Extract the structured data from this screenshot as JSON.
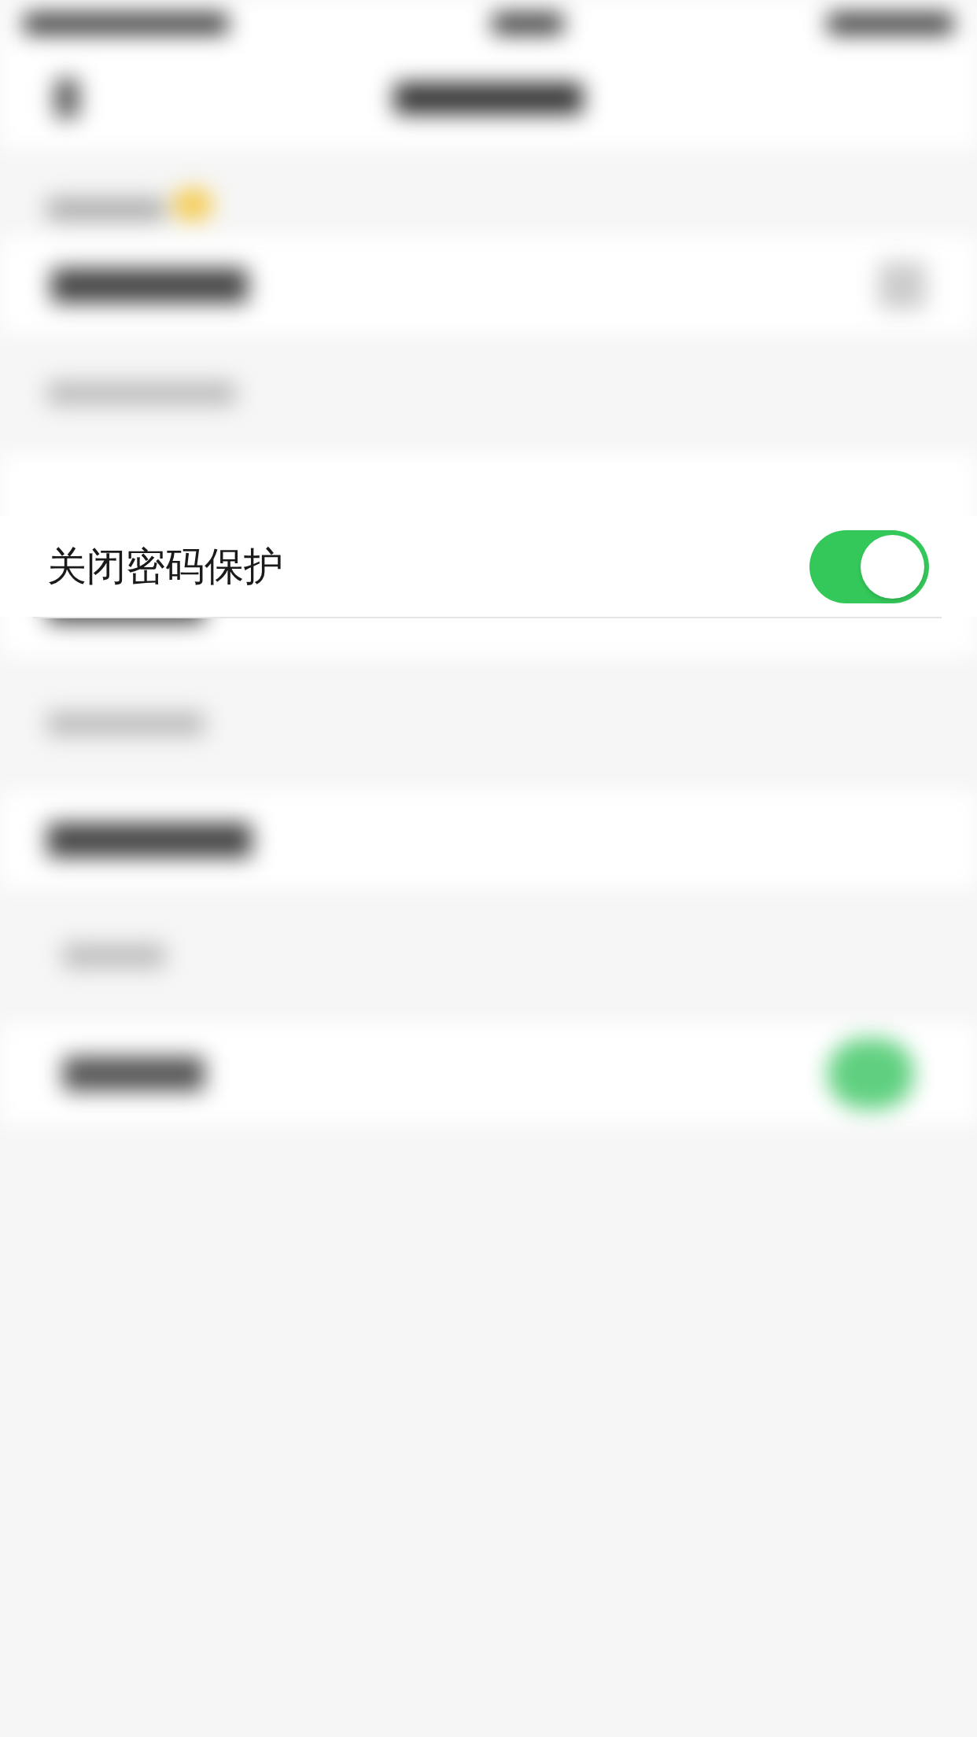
{
  "setting_row": {
    "label": "关闭密码保护",
    "on": true
  }
}
